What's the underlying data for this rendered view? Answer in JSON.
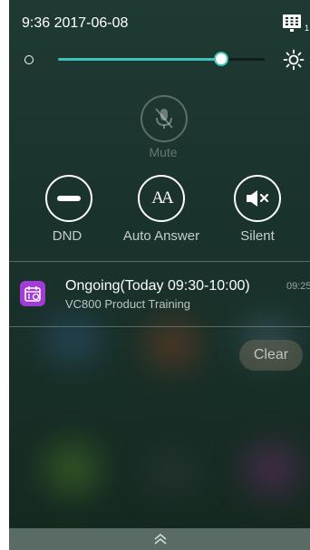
{
  "status_bar": {
    "time_date": "9:36 2017-06-08",
    "device_icon": "keypad-icon",
    "device_icon_sub": "1"
  },
  "brightness": {
    "level_percent": 79,
    "low_icon": "brightness-low-icon",
    "high_icon": "sun-icon"
  },
  "controls": {
    "mute": {
      "label": "Mute",
      "icon": "mic-off-icon",
      "enabled": false
    },
    "dnd": {
      "label": "DND",
      "icon": "minus-circle-icon"
    },
    "auto_answer": {
      "label": "Auto Answer",
      "icon": "auto-answer-icon",
      "glyph": "AA"
    },
    "silent": {
      "label": "Silent",
      "icon": "speaker-mute-icon"
    }
  },
  "notification": {
    "app_icon": "calendar-icon",
    "title": "Ongoing(Today 09:30-10:00)",
    "subtitle": "VC800 Product Training",
    "time": "09:25"
  },
  "clear_label": "Clear",
  "bottom_icon": "chevron-up-icon",
  "colors": {
    "accent": "#3ec1b6",
    "calendar_app": "#a33bd6",
    "background": "#1b332d"
  }
}
